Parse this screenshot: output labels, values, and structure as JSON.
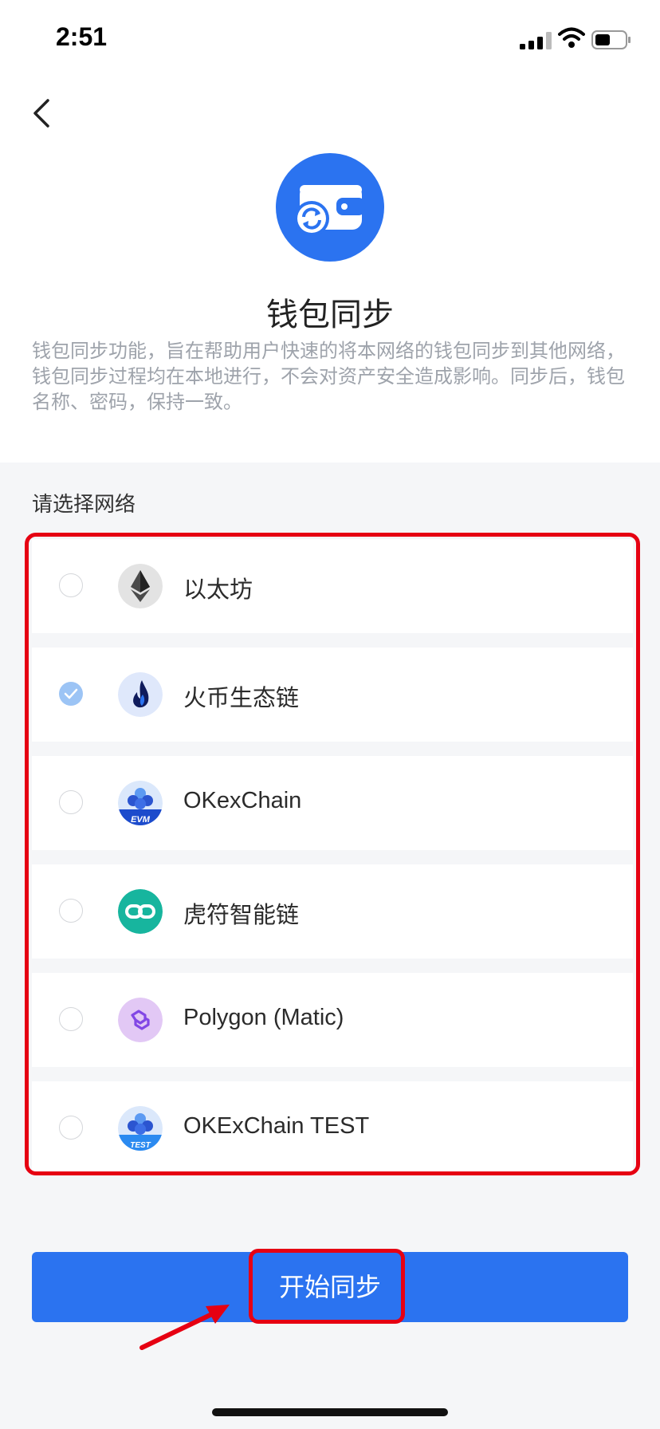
{
  "status_bar": {
    "time": "2:51"
  },
  "header": {
    "title": "钱包同步"
  },
  "description": "钱包同步功能，旨在帮助用户快速的将本网络的钱包同步到其他网络，钱包同步过程均在本地进行，不会对资产安全造成影响。同步后，钱包名称、密码，保持一致。",
  "section_label": "请选择网络",
  "networks": [
    {
      "name": "以太坊",
      "icon": "ethereum-icon",
      "selected": false
    },
    {
      "name": "火币生态链",
      "icon": "heco-icon",
      "selected": true
    },
    {
      "name": "OKexChain",
      "icon": "okexchain-evm-icon",
      "selected": false
    },
    {
      "name": "虎符智能链",
      "icon": "hoo-chain-icon",
      "selected": false
    },
    {
      "name": "Polygon (Matic)",
      "icon": "polygon-icon",
      "selected": false
    },
    {
      "name": "OKExChain TEST",
      "icon": "okexchain-test-icon",
      "selected": false
    }
  ],
  "icon_badges": {
    "okexchain": "EVM",
    "okexchain_test": "TEST"
  },
  "action": {
    "sync_label": "开始同步"
  },
  "colors": {
    "primary": "#2b73f0",
    "annotation": "#e60012",
    "selected_radio": "#9cc4f5",
    "background": "#f5f6f8"
  }
}
